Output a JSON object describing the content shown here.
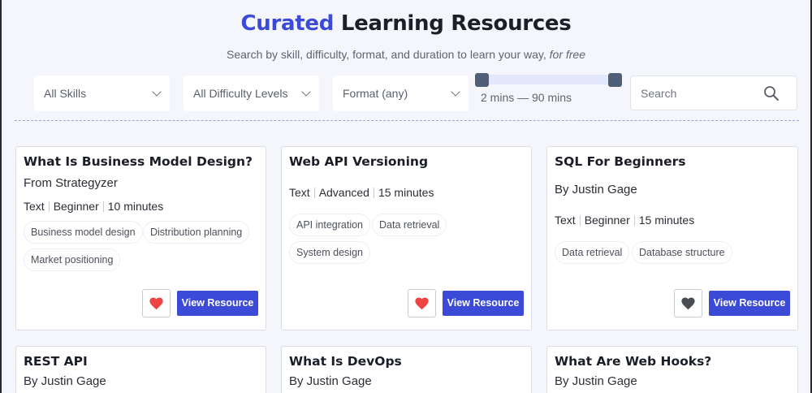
{
  "header": {
    "title_accent": "Curated",
    "title_rest": " Learning Resources",
    "subtitle_main": "Search by skill, difficulty, format, and duration to learn your way, ",
    "subtitle_em": "for free"
  },
  "filters": {
    "skills": "All Skills",
    "difficulty": "All Difficulty Levels",
    "format": "Format (any)",
    "duration": {
      "label": "2 mins — 90 mins",
      "min": 2,
      "max": 90
    },
    "search_placeholder": "Search"
  },
  "cards": [
    {
      "title": "What Is Business Model Design?",
      "author": "From Strategyzer",
      "format": "Text",
      "level": "Beginner",
      "duration": "10 minutes",
      "tags": [
        "Business model design",
        "Distribution planning",
        "Market positioning"
      ],
      "favorited": true,
      "button": "View Resource"
    },
    {
      "title": "Web API Versioning",
      "author": "",
      "format": "Text",
      "level": "Advanced",
      "duration": "15 minutes",
      "tags": [
        "API integration",
        "Data retrieval",
        "System design"
      ],
      "favorited": true,
      "button": "View Resource"
    },
    {
      "title": "SQL For Beginners",
      "author": "By Justin Gage",
      "format": "Text",
      "level": "Beginner",
      "duration": "15 minutes",
      "tags": [
        "Data retrieval",
        "Database structure"
      ],
      "favorited": false,
      "button": "View Resource"
    },
    {
      "title": "REST API",
      "author": "By Justin Gage"
    },
    {
      "title": "What Is DevOps",
      "author": "By Justin Gage"
    },
    {
      "title": "What Are Web Hooks?",
      "author": "By Justin Gage"
    }
  ],
  "colors": {
    "accent": "#3b4bd8",
    "heart_active": "#ef4444",
    "heart_inactive": "#4a4d55"
  }
}
